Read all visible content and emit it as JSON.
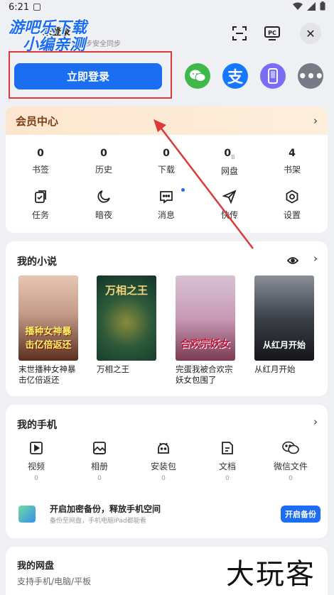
{
  "status_bar": {
    "time": "6:21"
  },
  "watermark": {
    "line1": "游吧乐下载",
    "line2": "小编亲测"
  },
  "header": {
    "username": "未登录",
    "login_hint": "登录后可以同步安全同步",
    "scan_icon": "scan-icon",
    "pc_icon": "pc-icon",
    "close_label": "✕"
  },
  "login": {
    "button_label": "立即登录"
  },
  "social": [
    {
      "name": "wechat-login",
      "icon": "wechat-icon",
      "color": "#3fb84a"
    },
    {
      "name": "alipay-login",
      "icon": "alipay-icon",
      "color": "#1677ff",
      "glyph": "支"
    },
    {
      "name": "phone-login",
      "icon": "phone-icon",
      "color": "#7b6cf6"
    },
    {
      "name": "more-login",
      "icon": "more-icon",
      "color": "#777b85",
      "glyph": "•••"
    }
  ],
  "vip": {
    "title": "会员中心",
    "chevron": "›"
  },
  "stats": [
    {
      "value": "0",
      "label": "书签"
    },
    {
      "value": "0",
      "label": "历史"
    },
    {
      "value": "0",
      "label": "下载"
    },
    {
      "value": "0",
      "unit": "B",
      "label": "网盘"
    },
    {
      "value": "4",
      "label": "书架"
    }
  ],
  "tools": [
    {
      "label": "任务",
      "icon": "task-icon"
    },
    {
      "label": "暗夜",
      "icon": "moon-icon"
    },
    {
      "label": "消息",
      "icon": "message-icon"
    },
    {
      "label": "快传",
      "icon": "send-icon"
    },
    {
      "label": "设置",
      "icon": "settings-icon"
    }
  ],
  "novels": {
    "title": "我的小说",
    "chevron": "›",
    "books": [
      {
        "title": "末世播种女神暴击亿倍返还",
        "cover_text": "播种女神暴击亿倍返还"
      },
      {
        "title": "万相之王",
        "cover_text": "万相之王"
      },
      {
        "title": "完蛋我被合欢宗妖女包围了",
        "cover_text": "合欢宗妖女"
      },
      {
        "title": "从红月开始",
        "cover_text": "从红月开始"
      }
    ]
  },
  "my_phone": {
    "title": "我的手机",
    "chevron": "›",
    "items": [
      {
        "label": "视频",
        "count": "0",
        "icon": "video-icon"
      },
      {
        "label": "相册",
        "count": "0",
        "icon": "album-icon"
      },
      {
        "label": "安装包",
        "count": "0",
        "icon": "android-icon"
      },
      {
        "label": "文档",
        "count": "0",
        "icon": "document-icon"
      },
      {
        "label": "微信文件",
        "count": "0",
        "icon": "wechat-file-icon"
      }
    ],
    "backup": {
      "title": "开启加密备份，释放手机空间",
      "subtitle": "备份至网盘，手机电脑iPad都能看",
      "button_label": "开启备份"
    }
  },
  "disk": {
    "title": "我的网盘",
    "subtitle": "支持手机/电脑/平板"
  },
  "corner_watermark": "大玩客",
  "colors": {
    "accent": "#1b6df2",
    "annotation_red": "#d93a3a",
    "vip_text": "#7a3d14"
  }
}
